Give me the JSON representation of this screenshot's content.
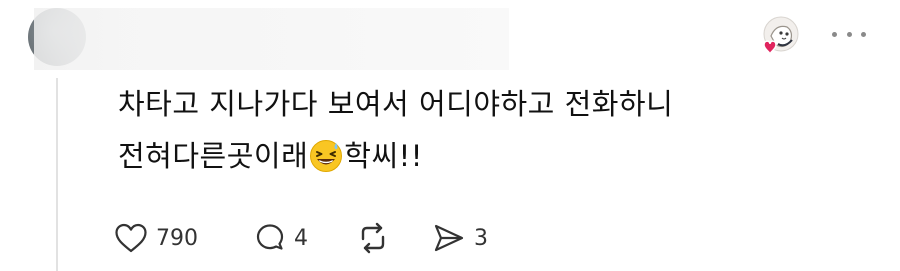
{
  "comment": {
    "line1": "차타고 지나가다 보여서 어디야하고 전화하니",
    "line2_before": "전혀다른곳이래",
    "emoji": "grinning-squinting-face-with-sweat",
    "line2_after": "학씨!!"
  },
  "actions": {
    "like_count": "790",
    "reply_count": "4",
    "share_count": "3"
  },
  "icons": {
    "more": "more-horizontal-icon",
    "like": "heart-outline-icon",
    "reply": "speech-bubble-icon",
    "repost": "repost-arrows-icon",
    "share": "send-arrow-icon"
  },
  "colors": {
    "text": "#111111",
    "muted": "#8a8a8a",
    "heart_badge": "#e0245e"
  }
}
